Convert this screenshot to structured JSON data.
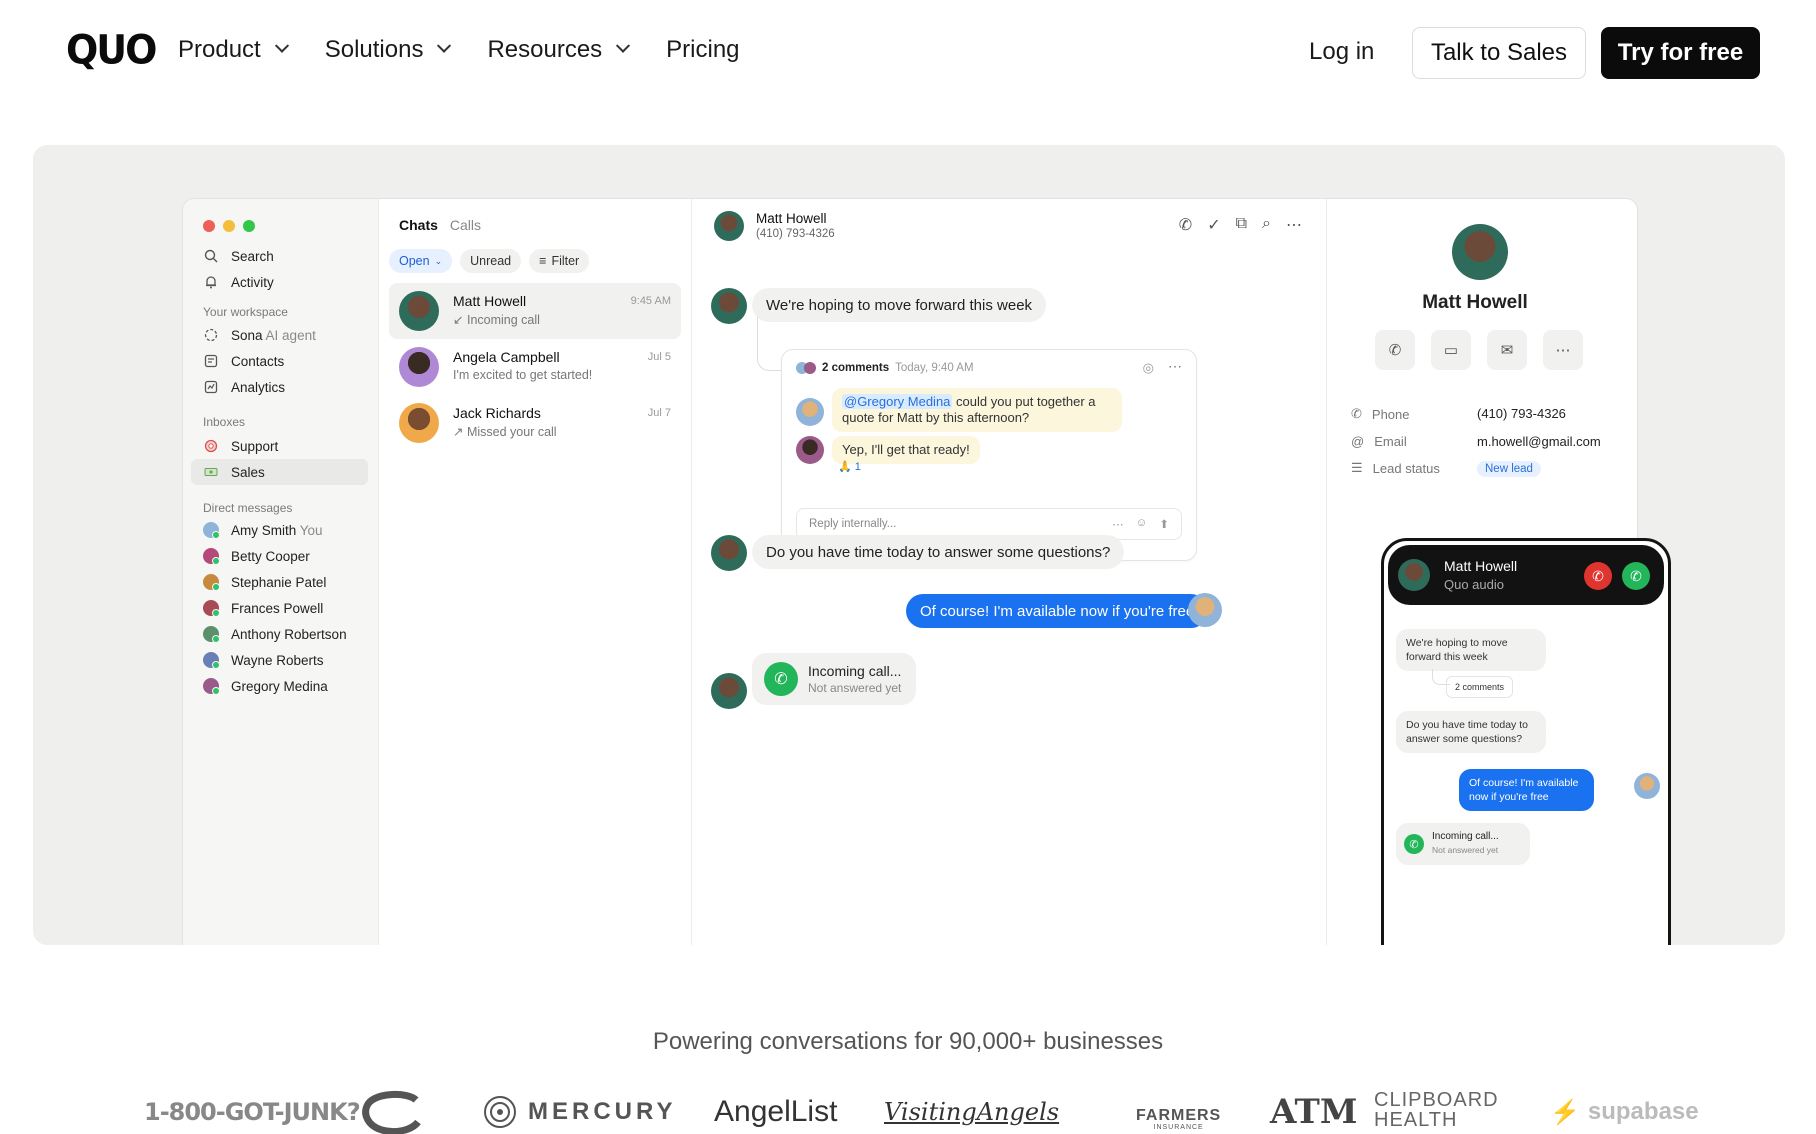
{
  "nav": {
    "logo": "QUO",
    "links": [
      {
        "label": "Product",
        "dropdown": true
      },
      {
        "label": "Solutions",
        "dropdown": true
      },
      {
        "label": "Resources",
        "dropdown": true
      },
      {
        "label": "Pricing",
        "dropdown": false
      }
    ],
    "login": "Log in",
    "talk_to_sales": "Talk to Sales",
    "try_free": "Try for free"
  },
  "sidebar": {
    "top_items": [
      {
        "label": "Search",
        "icon": "search-icon"
      },
      {
        "label": "Activity",
        "icon": "bell-icon"
      }
    ],
    "workspace_heading": "Your workspace",
    "workspace_items": [
      {
        "label": "Sona",
        "suffix": "AI agent",
        "icon": "sona-icon"
      },
      {
        "label": "Contacts",
        "icon": "contacts-icon"
      },
      {
        "label": "Analytics",
        "icon": "analytics-icon"
      }
    ],
    "inboxes_heading": "Inboxes",
    "inboxes": [
      {
        "label": "Support",
        "icon": "lifebuoy-icon"
      },
      {
        "label": "Sales",
        "icon": "money-icon",
        "active": true
      }
    ],
    "dm_heading": "Direct messages",
    "dms": [
      {
        "label": "Amy Smith",
        "suffix": "You"
      },
      {
        "label": "Betty Cooper"
      },
      {
        "label": "Stephanie Patel"
      },
      {
        "label": "Frances Powell"
      },
      {
        "label": "Anthony Robertson"
      },
      {
        "label": "Wayne Roberts"
      },
      {
        "label": "Gregory Medina"
      }
    ]
  },
  "chat_list": {
    "tab_chats": "Chats",
    "tab_calls": "Calls",
    "filter_open": "Open",
    "filter_unread": "Unread",
    "filter_filter": "Filter",
    "conversations": [
      {
        "name": "Matt Howell",
        "sub": "Incoming call",
        "time": "9:45 AM"
      },
      {
        "name": "Angela Campbell",
        "sub": "I'm excited to get started!",
        "time": "Jul 5"
      },
      {
        "name": "Jack Richards",
        "sub": "Missed your call",
        "time": "Jul 7"
      }
    ]
  },
  "conversation": {
    "contact_name": "Matt Howell",
    "contact_phone": "(410) 793-4326",
    "msg1": "We're hoping to move forward this week",
    "thread": {
      "comments": "2 comments",
      "time": "Today, 9:40 AM",
      "mention": "@Gregory Medina",
      "note1": " could you put together a quote for Matt by this afternoon?",
      "note2": "Yep, I'll get that ready!",
      "reaction": "🙏 1",
      "reply_placeholder": "Reply internally..."
    },
    "msg2": "Do you have time today to answer some questions?",
    "msg3": "Of course! I'm available now if you're free",
    "call_title": "Incoming call...",
    "call_sub": "Not answered yet"
  },
  "contact_panel": {
    "name": "Matt Howell",
    "phone_label": "Phone",
    "phone": "(410) 793-4326",
    "email_label": "Email",
    "email": "m.howell@gmail.com",
    "lead_label": "Lead status",
    "lead_value": "New lead"
  },
  "phone_mock": {
    "caller": "Matt Howell",
    "caller_sub": "Quo audio",
    "msg1": "We're hoping to move forward this week",
    "comments": "2 comments",
    "msg2": "Do you have time today to answer some questions?",
    "msg3": "Of course! I'm available now if you're free",
    "call_title": "Incoming call...",
    "call_sub": "Not answered yet"
  },
  "footer": {
    "tagline": "Powering conversations for 90,000+ businesses",
    "logos": [
      "1-800-GOT-JUNK?",
      "Mercury",
      "AngelList",
      "Visiting Angels",
      "Farmers Insurance",
      "ATM",
      "CLIPBOARD HEALTH",
      "supabase"
    ],
    "mercury": "MERCURY",
    "angellist": "AngelList",
    "visiting": "VisitingAngels",
    "farmers": "FARMERS",
    "farmers_sub": "INSURANCE",
    "atm": "ATM",
    "clipboard_1": "CLIPBOARD",
    "clipboard_2": "HEALTH",
    "supabase": "supabase",
    "gotjunk": "1-800-GOT-JUNK?"
  },
  "colors": {
    "brand_dark": "#0b0b0b",
    "accent_blue": "#1b72f0",
    "call_green": "#22b559",
    "decline_red": "#e0342f",
    "hero_bg": "#efefed"
  }
}
